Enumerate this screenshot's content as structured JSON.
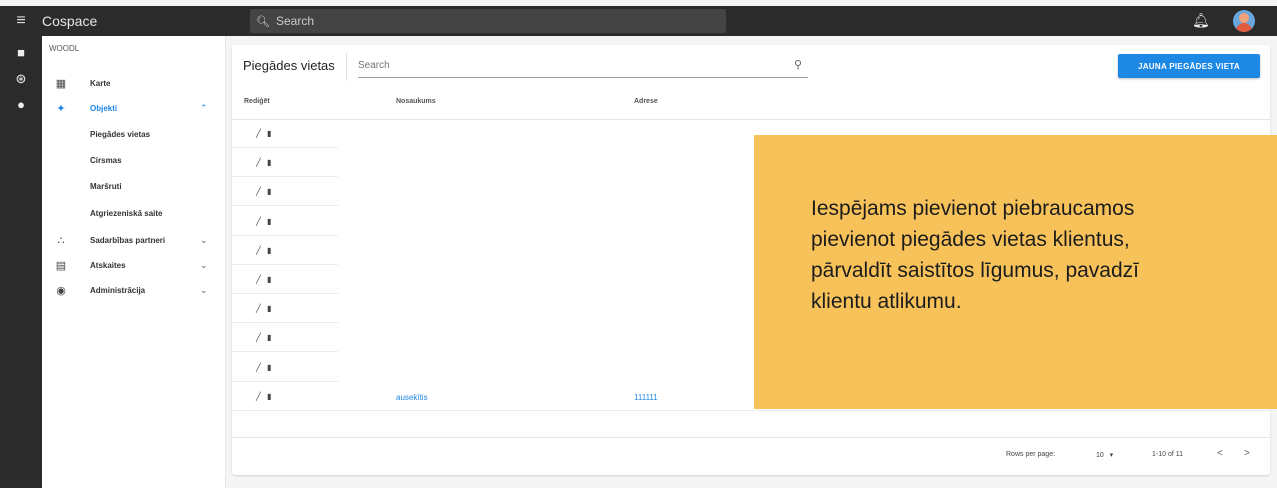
{
  "topbar": {
    "menu_icon": "hamburger-icon",
    "app_title": "Cospace",
    "search_placeholder": "Search",
    "icons": [
      "search-icon",
      "bell-icon",
      "user-avatar"
    ]
  },
  "rail": {
    "icons": [
      "folder-icon",
      "tree-icon",
      "person-icon"
    ]
  },
  "sidenav": {
    "org": "WOODL",
    "items": [
      {
        "label": "Karte",
        "icon": "map-icon"
      },
      {
        "label": "Objekti",
        "icon": "objects-icon",
        "active": true,
        "expanded": true
      },
      {
        "label": "Sadarbības partneri",
        "icon": "partners-icon"
      },
      {
        "label": "Atskaites",
        "icon": "report-icon"
      },
      {
        "label": "Administrācija",
        "icon": "account-icon"
      }
    ],
    "subitems": [
      "Piegādes vietas",
      "Cirsmas",
      "Maršruti",
      "Atgriezeniskā saite"
    ]
  },
  "main": {
    "title": "Piegādes vietas",
    "search_placeholder": "Search",
    "new_button": "JAUNA PIEGĀDES VIETA",
    "columns": [
      "Rediģēt",
      "Nosaukums",
      "Adrese"
    ],
    "rows": [
      {
        "name": "",
        "address": ""
      },
      {
        "name": "",
        "address": ""
      },
      {
        "name": "",
        "address": ""
      },
      {
        "name": "",
        "address": ""
      },
      {
        "name": "",
        "address": ""
      },
      {
        "name": "",
        "address": ""
      },
      {
        "name": "",
        "address": ""
      },
      {
        "name": "",
        "address": ""
      },
      {
        "name": "",
        "address": ""
      },
      {
        "name": "ausekītis",
        "address": "111111"
      }
    ],
    "row_actions": "✎ 🗑",
    "pagination": {
      "rows_per_page_label": "Rows per page:",
      "rows_per_page": "10",
      "range": "1-10 of 11",
      "prev": "<",
      "next": ">"
    }
  },
  "callout": {
    "text": "Iespējams pievienot piebraucamos\npievienot piegādes vietas klientus,\npārvaldīt saistītos līgumus, pavadzī\nklientu atlikumu.",
    "color": "#f8c25a"
  },
  "accent_color": "#1e88e5"
}
